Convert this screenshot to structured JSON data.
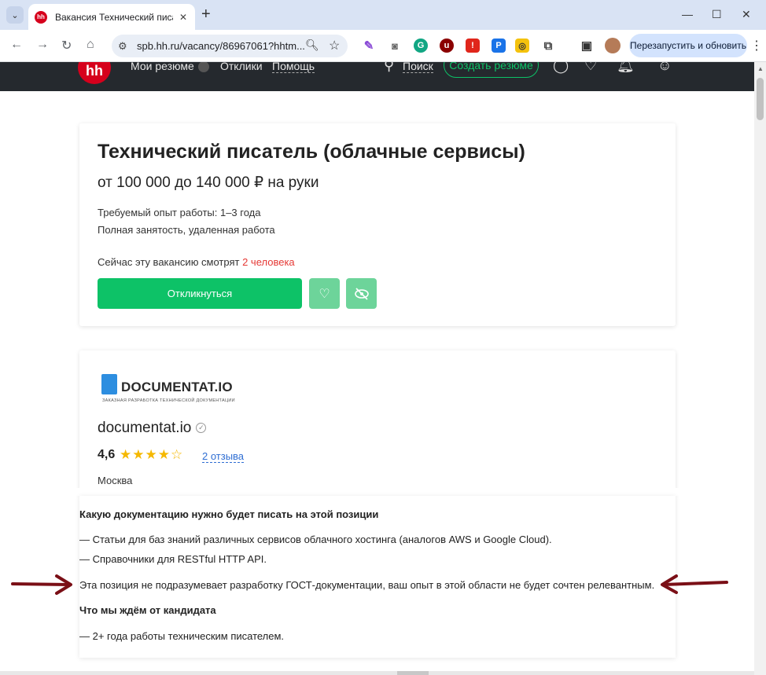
{
  "browser": {
    "tab_title": "Вакансия Технический писате",
    "favicon_text": "hh",
    "url": "spb.hh.ru/vacancy/86967061?hhtm...",
    "restart_label": "Перезапустить и обновить"
  },
  "site_header": {
    "logo_text": "hh",
    "nav": [
      "Мои резюме",
      "Отклики",
      "Помощь"
    ],
    "search_label": "Поиск",
    "create_resume_label": "Создать резюме"
  },
  "vacancy": {
    "title": "Технический писатель (облачные сервисы)",
    "salary": "от 100 000 до 140 000 ₽ на руки",
    "experience": "Требуемый опыт работы: 1–3 года",
    "employment": "Полная занятость, удаленная работа",
    "viewers_prefix": "Сейчас эту вакансию смотрят ",
    "viewers_count": "2 человека",
    "apply_label": "Откликнуться"
  },
  "company": {
    "logo_name": "DOCUMENTAT.IO",
    "logo_tagline": "ЗАКАЗНАЯ РАЗРАБОТКА ТЕХНИЧЕСКОЙ ДОКУМЕНТАЦИИ",
    "name": "documentat.io",
    "rating": "4,6",
    "reviews": "2 отзыва",
    "city": "Москва"
  },
  "description": {
    "heading1": "Какую документацию нужно будет писать на этой позиции",
    "item1": "— Статьи для баз знаний различных сервисов облачного хостинга (аналогов AWS и Google Cloud).",
    "item2": "— Справочники для RESTful HTTP API.",
    "note": "Эта позиция не подразумевает разработку ГОСТ-документации, ваш опыт в этой области не будет сочтен релевантным.",
    "heading2": "Что мы ждём от кандидата",
    "item3": "— 2+ года работы техническим писателем."
  },
  "colors": {
    "brand_red": "#d6001c",
    "apply_green": "#0dc267",
    "arrow": "#7a0f16",
    "link_blue": "#2f6ed3"
  }
}
